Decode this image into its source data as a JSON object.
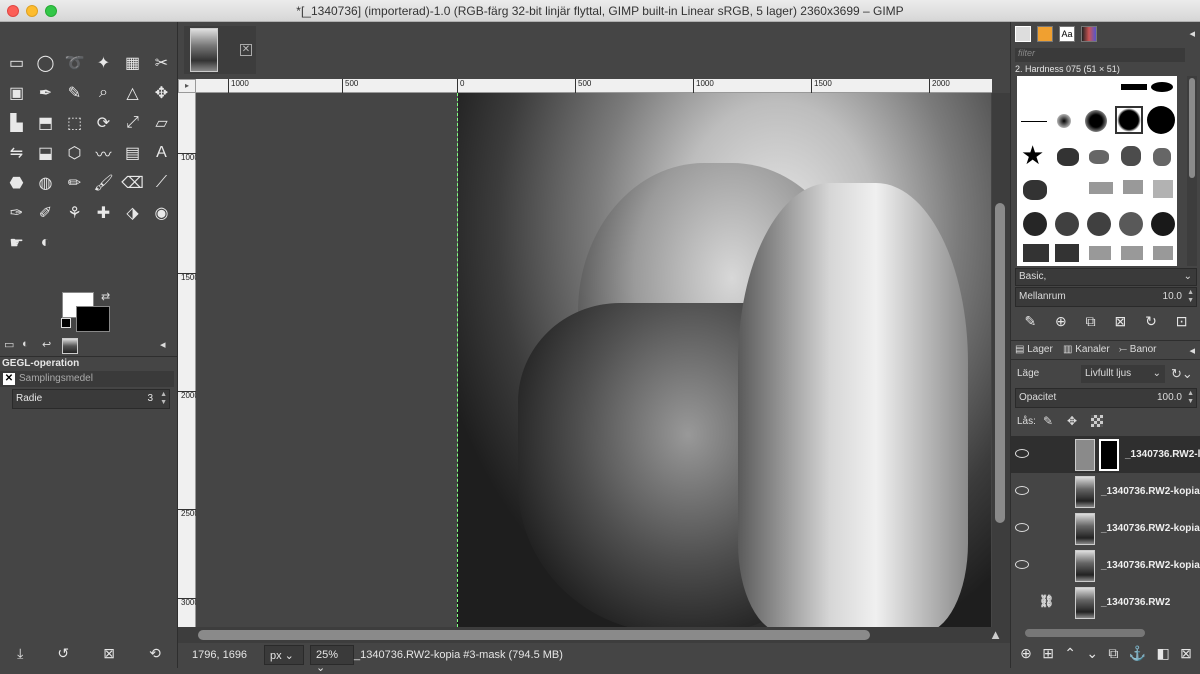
{
  "window": {
    "title": "*[_1340736] (importerad)-1.0 (RGB-färg 32-bit linjär flyttal, GIMP built-in Linear sRGB, 5 lager) 2360x3699 – GIMP"
  },
  "toolbox": {
    "tools": [
      "rect-select",
      "ellipse-select",
      "free-select",
      "fuzzy-select",
      "by-color-select",
      "scissors-select",
      "foreground-select",
      "paths",
      "color-picker",
      "zoom",
      "measure",
      "move",
      "align",
      "crop",
      "unified-transform",
      "rotate",
      "scale",
      "shear",
      "flip",
      "perspective",
      "cage",
      "warp",
      "gradient",
      "text",
      "bucket-fill",
      "blend",
      "pencil",
      "paintbrush",
      "eraser",
      "airbrush",
      "ink",
      "mypaint",
      "clone",
      "heal",
      "perspective-clone",
      "blur",
      "smudge",
      "dodge-burn"
    ],
    "panel_title": "GEGL-operation",
    "operation_label": "Samplingsmedel",
    "radius_label": "Radie",
    "radius_value": "3"
  },
  "ruler": {
    "h_ticks": [
      "1000",
      "500",
      "0",
      "500",
      "1000",
      "1500",
      "2000"
    ],
    "v_ticks": [
      "1000",
      "1500",
      "2000",
      "2500",
      "3000"
    ]
  },
  "status": {
    "coords": "1796, 1696",
    "unit": "px",
    "zoom": "25%",
    "message": "_1340736.RW2-kopia #3-mask (794.5 MB)"
  },
  "brushes": {
    "filter_placeholder": "filter",
    "selected_brush": "2. Hardness 075 (51 × 51)",
    "preset": "Basic,",
    "spacing_label": "Mellanrum",
    "spacing_value": "10.0"
  },
  "layers_panel": {
    "tabs": [
      "Lager",
      "Kanaler",
      "Banor"
    ],
    "mode_label": "Läge",
    "mode_value": "Livfullt ljus",
    "opacity_label": "Opacitet",
    "opacity_value": "100.0",
    "lock_label": "Lås:",
    "layers": [
      {
        "name": "_1340736.RW2-l",
        "selected": true,
        "visible": true,
        "has_mask": true
      },
      {
        "name": "_1340736.RW2-kopia",
        "selected": false,
        "visible": true,
        "has_mask": false
      },
      {
        "name": "_1340736.RW2-kopia",
        "selected": false,
        "visible": true,
        "has_mask": false
      },
      {
        "name": "_1340736.RW2-kopia",
        "selected": false,
        "visible": true,
        "has_mask": false
      },
      {
        "name": "_1340736.RW2",
        "selected": false,
        "visible": false,
        "has_mask": false
      }
    ]
  }
}
